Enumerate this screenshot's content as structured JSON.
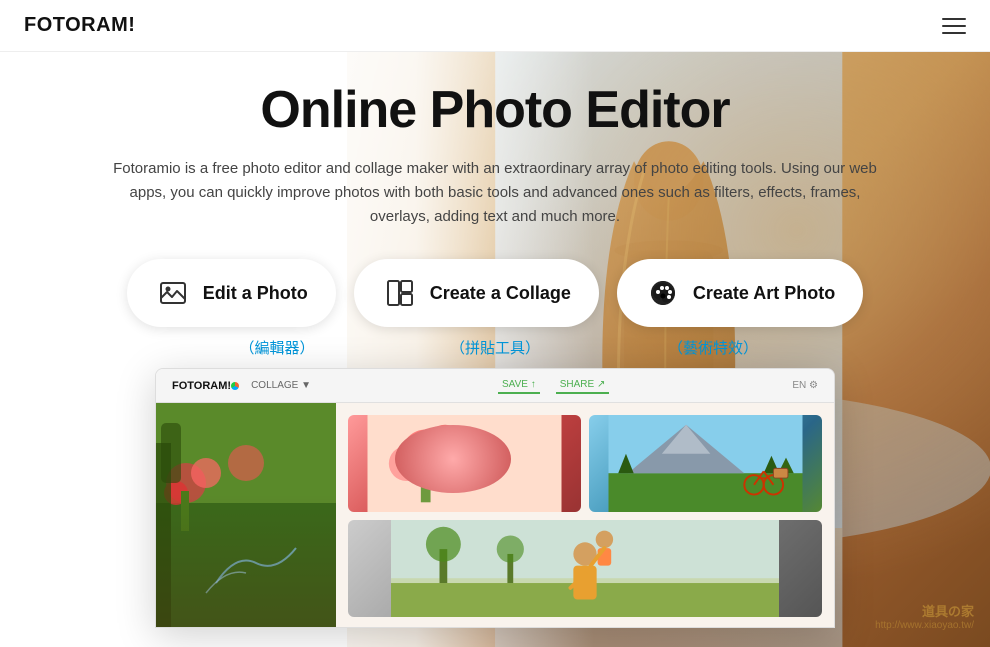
{
  "navbar": {
    "logo_text": "FOTORAM!",
    "hamburger_label": "Menu"
  },
  "hero": {
    "title": "Online Photo Editor",
    "description": "Fotoramio is a free photo editor and collage maker with an extraordinary array of photo editing tools. Using our web apps, you can quickly improve photos with both basic tools and advanced ones such as filters, effects, frames, overlays, adding text and much more.",
    "buttons": [
      {
        "id": "edit-photo",
        "label": "Edit a Photo",
        "chinese_label": "（編輯器）",
        "icon": "image-icon"
      },
      {
        "id": "create-collage",
        "label": "Create a Collage",
        "chinese_label": "（拼貼工具）",
        "icon": "collage-icon"
      },
      {
        "id": "create-art",
        "label": "Create Art Photo",
        "chinese_label": "（藝術特效）",
        "icon": "palette-icon"
      }
    ]
  },
  "screenshot": {
    "logo": "FOTORAM!O",
    "nav_items": [
      "COLLAGE ▼"
    ],
    "save_label": "SAVE ↑",
    "share_label": "SHARE ↗",
    "lang_label": "EN ⚙"
  },
  "watermark": {
    "line1": "道具の家",
    "line2": "http://www.xiaoyao.tw/"
  }
}
